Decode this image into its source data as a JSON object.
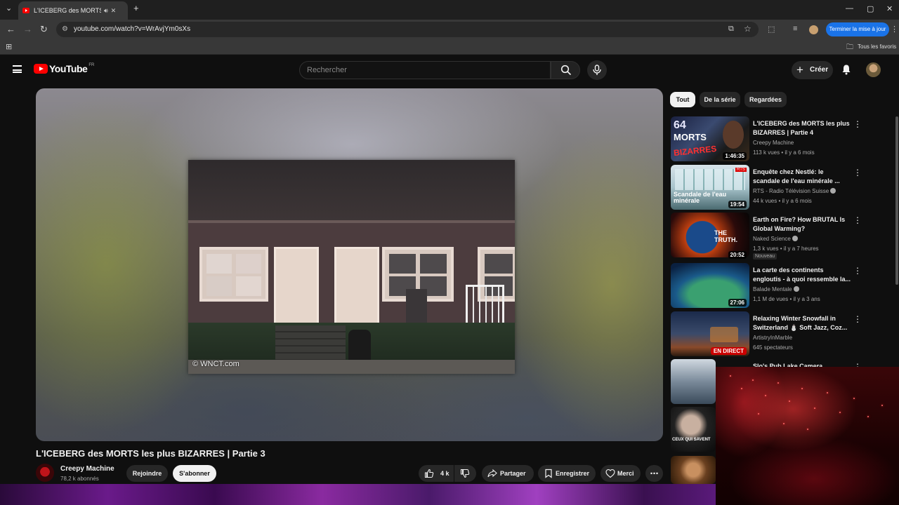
{
  "browser": {
    "tab_title": "L'ICEBERG des MORTS les plus",
    "url": "youtube.com/watch?v=WrAvjYm0sXs",
    "update_button": "Terminer la mise à jour",
    "bookmarks_label": "Tous les favoris"
  },
  "masthead": {
    "logo_text": "YouTube",
    "country_code": "FR",
    "search_placeholder": "Rechercher",
    "create_label": "Créer"
  },
  "player": {
    "watermark": "© WNCT.com"
  },
  "video": {
    "title": "L'ICEBERG des MORTS les plus BIZARRES | Partie 3",
    "channel_name": "Creepy Machine",
    "subscribers": "78,2 k abonnés",
    "join_label": "Rejoindre",
    "subscribe_label": "S'abonner",
    "likes": "4 k",
    "share_label": "Partager",
    "save_label": "Enregistrer",
    "thanks_label": "Merci"
  },
  "chips": [
    "Tout",
    "De la série",
    "Regardées"
  ],
  "recommendations": [
    {
      "title": "L'ICEBERG des MORTS les plus BIZARRES | Partie 4",
      "channel": "Creepy Machine",
      "meta": "113 k vues • il y a 6 mois",
      "duration": "1:46:35",
      "verified": false
    },
    {
      "title": "Enquête chez Nestlé: le scandale de l'eau minérale ...",
      "channel": "RTS - Radio Télévision Suisse",
      "meta": "44 k vues • il y a 6 mois",
      "duration": "19:54",
      "verified": true,
      "thumb_text": "Scandale de l'eau minérale"
    },
    {
      "title": "Earth on Fire? How BRUTAL Is Global Warming?",
      "channel": "Naked Science",
      "meta": "1,3 k vues • il y a 7 heures",
      "duration": "20:52",
      "verified": true,
      "badge": "Nouveau",
      "thumb_text": "THE TRUTH."
    },
    {
      "title": "La carte des continents engloutis - à quoi ressemble la...",
      "channel": "Balade Mentale",
      "meta": "1,1 M de vues • il y a 3 ans",
      "duration": "27:06",
      "verified": true
    },
    {
      "title": "Relaxing Winter Snowfall in Switzerland ⛄ Soft Jazz, Coz...",
      "channel": "ArtistryInMarble",
      "meta": "645 spectateurs",
      "live_label": "EN DIRECT",
      "verified": false
    },
    {
      "title": "Slo's Pub Lake Camera",
      "channel": "",
      "meta": "",
      "verified": false
    },
    {
      "title": "",
      "channel": "",
      "meta": "",
      "verified": false,
      "thumb_text": "CEUX QUI SAVENT"
    },
    {
      "title": "",
      "channel": "",
      "meta": "",
      "verified": false
    }
  ],
  "colors": {
    "brand_red": "#ff0000",
    "background": "#0f0f0f",
    "chrome_blue": "#1a73e8"
  }
}
